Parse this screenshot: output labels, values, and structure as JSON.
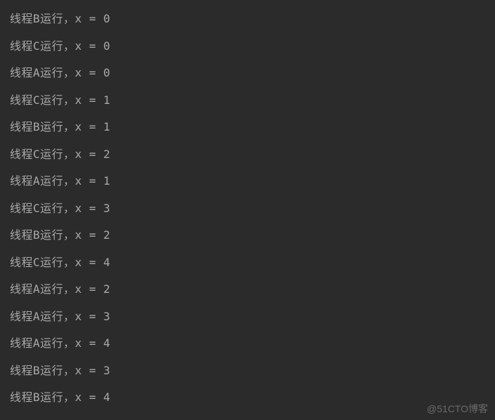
{
  "console": {
    "lines": [
      "线程B运行，x = 0",
      "线程C运行，x = 0",
      "线程A运行，x = 0",
      "线程C运行，x = 1",
      "线程B运行，x = 1",
      "线程C运行，x = 2",
      "线程A运行，x = 1",
      "线程C运行，x = 3",
      "线程B运行，x = 2",
      "线程C运行，x = 4",
      "线程A运行，x = 2",
      "线程A运行，x = 3",
      "线程A运行，x = 4",
      "线程B运行，x = 3",
      "线程B运行，x = 4"
    ]
  },
  "watermark": "@51CTO博客"
}
